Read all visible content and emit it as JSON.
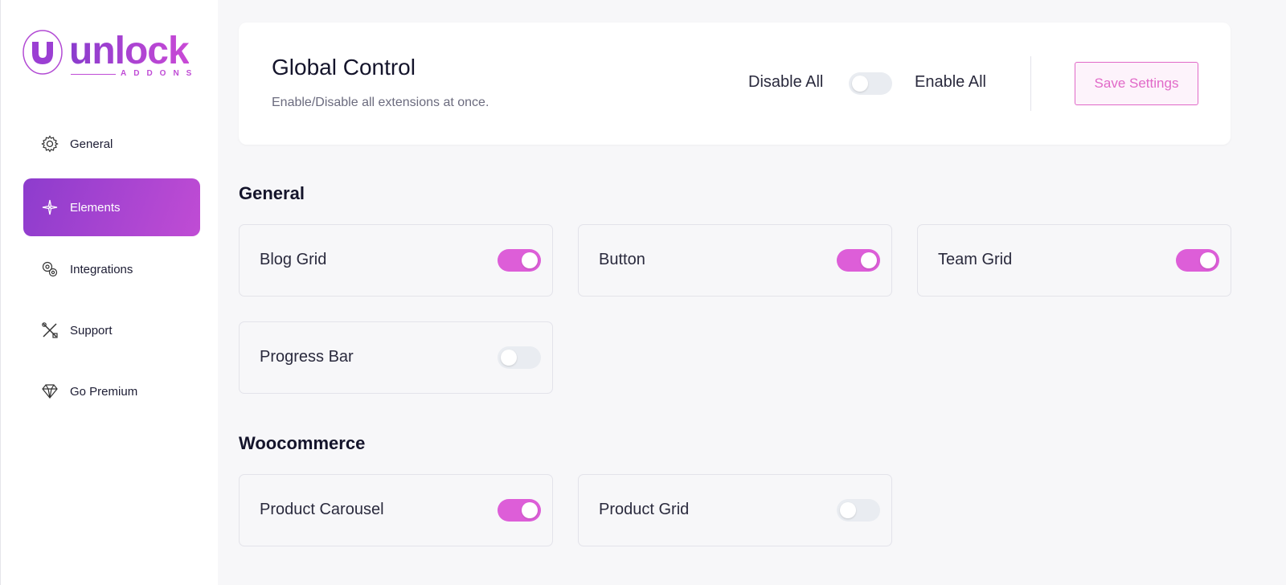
{
  "brand": {
    "name": "unlock",
    "sub": "ADDONS",
    "accent": "#c04cd4",
    "gradient_start": "#8d3ccd"
  },
  "sidebar": {
    "items": [
      {
        "label": "General",
        "icon": "gear-icon",
        "active": false
      },
      {
        "label": "Elements",
        "icon": "sparkle-icon",
        "active": true
      },
      {
        "label": "Integrations",
        "icon": "cogs-icon",
        "active": false
      },
      {
        "label": "Support",
        "icon": "tools-icon",
        "active": false
      },
      {
        "label": "Go Premium",
        "icon": "diamond-icon",
        "active": false
      }
    ]
  },
  "global_control": {
    "title": "Global Control",
    "subtitle": "Enable/Disable all extensions at once.",
    "disable_label": "Disable All",
    "enable_label": "Enable All",
    "toggle_on": false,
    "save_label": "Save Settings"
  },
  "sections": [
    {
      "title": "General",
      "elements": [
        {
          "label": "Blog Grid",
          "enabled": true
        },
        {
          "label": "Button",
          "enabled": true
        },
        {
          "label": "Team Grid",
          "enabled": true
        },
        {
          "label": "Progress Bar",
          "enabled": false
        }
      ]
    },
    {
      "title": "Woocommerce",
      "elements": [
        {
          "label": "Product Carousel",
          "enabled": true
        },
        {
          "label": "Product Grid",
          "enabled": false
        }
      ]
    }
  ],
  "colors": {
    "toggle_on": "#dd5ed8",
    "toggle_off": "#e9ecf1",
    "save_border": "#e169c8"
  }
}
